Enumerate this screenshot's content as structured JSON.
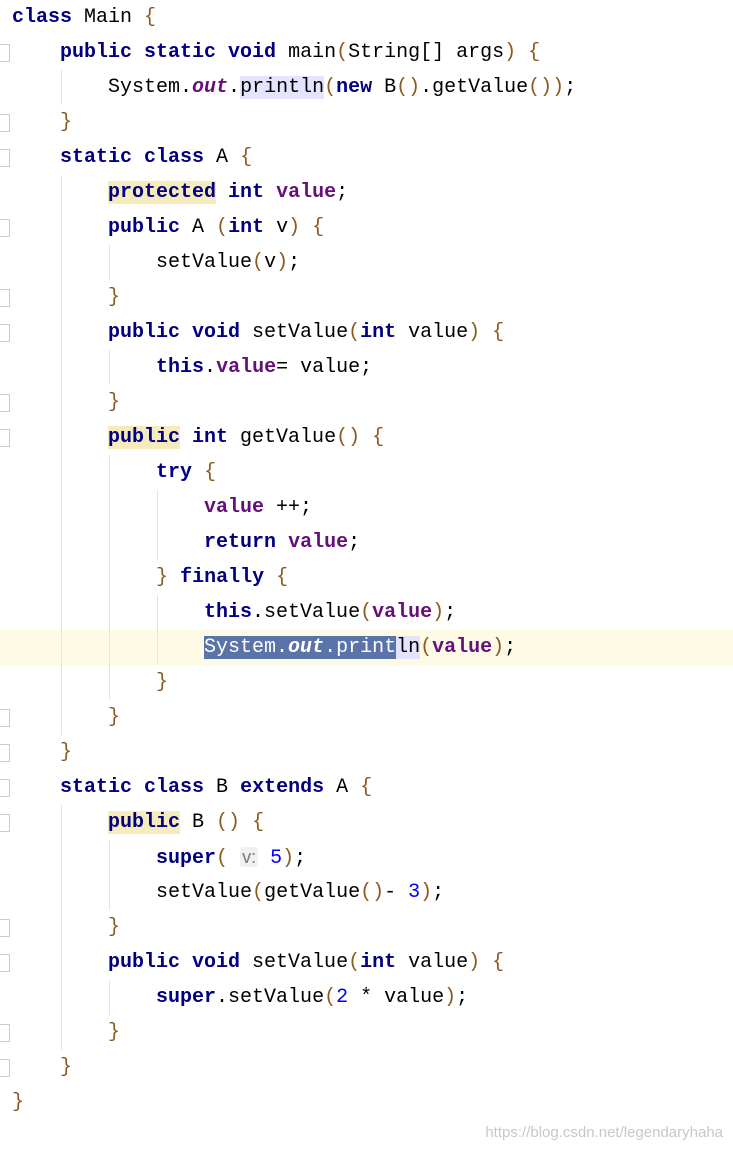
{
  "editor": {
    "colors": {
      "keyword": "#000080",
      "field": "#660e7a",
      "number": "#0000ff",
      "brace": "#8a5a1e",
      "selection": "#5a73a8",
      "current_line": "#fdfae6"
    },
    "current_line": 18,
    "lines": [
      {
        "indent": 0,
        "fold": false,
        "tokens": [
          [
            "class",
            "k"
          ],
          [
            " Main ",
            "p"
          ],
          [
            "{",
            "b"
          ]
        ]
      },
      {
        "indent": 1,
        "fold": true,
        "tokens": [
          [
            "public static void",
            "k"
          ],
          [
            " main",
            "p"
          ],
          [
            "(",
            "b"
          ],
          [
            "String[] args",
            "p"
          ],
          [
            ")",
            "b"
          ],
          [
            " ",
            "p"
          ],
          [
            "{",
            "b"
          ]
        ]
      },
      {
        "indent": 2,
        "fold": false,
        "tokens": [
          [
            "System.",
            "p"
          ],
          [
            "out",
            "i"
          ],
          [
            ".",
            "p"
          ],
          [
            "println",
            "p",
            "hl-u"
          ],
          [
            "(",
            "b"
          ],
          [
            "new",
            "k"
          ],
          [
            " B",
            "p"
          ],
          [
            "()",
            "b"
          ],
          [
            ".getValue",
            "p"
          ],
          [
            "())",
            "b"
          ],
          [
            ";",
            "p"
          ]
        ]
      },
      {
        "indent": 1,
        "fold": true,
        "tokens": [
          [
            "}",
            "b"
          ]
        ]
      },
      {
        "indent": 1,
        "fold": true,
        "tokens": [
          [
            "static class",
            "k"
          ],
          [
            " A ",
            "p"
          ],
          [
            "{",
            "b"
          ]
        ]
      },
      {
        "indent": 2,
        "fold": false,
        "tokens": [
          [
            "protected",
            "k",
            "hl-y"
          ],
          [
            " int",
            "k"
          ],
          [
            " ",
            "p"
          ],
          [
            "value",
            "f"
          ],
          [
            ";",
            "p"
          ]
        ]
      },
      {
        "indent": 2,
        "fold": true,
        "tokens": [
          [
            "public",
            "k"
          ],
          [
            " A ",
            "p"
          ],
          [
            "(",
            "b"
          ],
          [
            "int",
            "k"
          ],
          [
            " v",
            "p"
          ],
          [
            ")",
            "b"
          ],
          [
            " ",
            "p"
          ],
          [
            "{",
            "b"
          ]
        ]
      },
      {
        "indent": 3,
        "fold": false,
        "tokens": [
          [
            "setValue",
            "p"
          ],
          [
            "(",
            "b"
          ],
          [
            "v",
            "p"
          ],
          [
            ")",
            "b"
          ],
          [
            ";",
            "p"
          ]
        ]
      },
      {
        "indent": 2,
        "fold": true,
        "tokens": [
          [
            "}",
            "b"
          ]
        ]
      },
      {
        "indent": 2,
        "fold": true,
        "tokens": [
          [
            "public void",
            "k"
          ],
          [
            " setValue",
            "p"
          ],
          [
            "(",
            "b"
          ],
          [
            "int",
            "k"
          ],
          [
            " value",
            "p"
          ],
          [
            ")",
            "b"
          ],
          [
            " ",
            "p"
          ],
          [
            "{",
            "b"
          ]
        ]
      },
      {
        "indent": 3,
        "fold": false,
        "tokens": [
          [
            "this",
            "k"
          ],
          [
            ".",
            "p"
          ],
          [
            "value",
            "f"
          ],
          [
            "= value;",
            "p"
          ]
        ]
      },
      {
        "indent": 2,
        "fold": true,
        "tokens": [
          [
            "}",
            "b"
          ]
        ]
      },
      {
        "indent": 2,
        "fold": true,
        "tokens": [
          [
            "public",
            "k",
            "hl-y"
          ],
          [
            " int",
            "k"
          ],
          [
            " getValue",
            "p"
          ],
          [
            "()",
            "b"
          ],
          [
            " ",
            "p"
          ],
          [
            "{",
            "b"
          ]
        ]
      },
      {
        "indent": 3,
        "fold": false,
        "tokens": [
          [
            "try",
            "k"
          ],
          [
            " ",
            "p"
          ],
          [
            "{",
            "b"
          ]
        ]
      },
      {
        "indent": 4,
        "fold": false,
        "tokens": [
          [
            "value",
            "f"
          ],
          [
            " ++;",
            "p"
          ]
        ]
      },
      {
        "indent": 4,
        "fold": false,
        "tokens": [
          [
            "return",
            "k"
          ],
          [
            " ",
            "p"
          ],
          [
            "value",
            "f"
          ],
          [
            ";",
            "p"
          ]
        ]
      },
      {
        "indent": 3,
        "fold": false,
        "tokens": [
          [
            "}",
            "b"
          ],
          [
            " ",
            "p"
          ],
          [
            "finally",
            "k"
          ],
          [
            " ",
            "p"
          ],
          [
            "{",
            "b"
          ]
        ]
      },
      {
        "indent": 4,
        "fold": false,
        "tokens": [
          [
            "this",
            "k"
          ],
          [
            ".setValue",
            "p"
          ],
          [
            "(",
            "b"
          ],
          [
            "value",
            "f"
          ],
          [
            ")",
            "b"
          ],
          [
            ";",
            "p"
          ]
        ]
      },
      {
        "indent": 4,
        "fold": false,
        "tokens": [
          [
            "System.",
            "p",
            "sel"
          ],
          [
            "out",
            "i",
            "sel"
          ],
          [
            ".print",
            "p",
            "sel"
          ],
          [
            "ln",
            "p",
            "hl-u"
          ],
          [
            "(",
            "b"
          ],
          [
            "value",
            "f"
          ],
          [
            ")",
            "b"
          ],
          [
            ";",
            "p"
          ]
        ]
      },
      {
        "indent": 3,
        "fold": false,
        "tokens": [
          [
            "}",
            "b"
          ]
        ]
      },
      {
        "indent": 2,
        "fold": true,
        "tokens": [
          [
            "}",
            "b"
          ]
        ]
      },
      {
        "indent": 1,
        "fold": true,
        "tokens": [
          [
            "}",
            "b"
          ]
        ]
      },
      {
        "indent": 1,
        "fold": true,
        "tokens": [
          [
            "static class",
            "k"
          ],
          [
            " B ",
            "p"
          ],
          [
            "extends",
            "k"
          ],
          [
            " A ",
            "p"
          ],
          [
            "{",
            "b"
          ]
        ]
      },
      {
        "indent": 2,
        "fold": true,
        "tokens": [
          [
            "public",
            "k",
            "hl-y"
          ],
          [
            " B ",
            "p"
          ],
          [
            "()",
            "b"
          ],
          [
            " ",
            "p"
          ],
          [
            "{",
            "b"
          ]
        ]
      },
      {
        "indent": 3,
        "fold": false,
        "tokens": [
          [
            "super",
            "k"
          ],
          [
            "(",
            "b"
          ],
          [
            " ",
            "p"
          ],
          [
            "v:",
            "h"
          ],
          [
            " ",
            "p"
          ],
          [
            "5",
            "n"
          ],
          [
            ")",
            "b"
          ],
          [
            ";",
            "p"
          ]
        ]
      },
      {
        "indent": 3,
        "fold": false,
        "tokens": [
          [
            "setValue",
            "p"
          ],
          [
            "(",
            "b"
          ],
          [
            "getValue",
            "p"
          ],
          [
            "()",
            "b"
          ],
          [
            "- ",
            "p"
          ],
          [
            "3",
            "n"
          ],
          [
            ")",
            "b"
          ],
          [
            ";",
            "p"
          ]
        ]
      },
      {
        "indent": 2,
        "fold": true,
        "tokens": [
          [
            "}",
            "b"
          ]
        ]
      },
      {
        "indent": 2,
        "fold": true,
        "tokens": [
          [
            "public void",
            "k"
          ],
          [
            " setValue",
            "p"
          ],
          [
            "(",
            "b"
          ],
          [
            "int",
            "k"
          ],
          [
            " value",
            "p"
          ],
          [
            ")",
            "b"
          ],
          [
            " ",
            "p"
          ],
          [
            "{",
            "b"
          ]
        ]
      },
      {
        "indent": 3,
        "fold": false,
        "tokens": [
          [
            "super",
            "k"
          ],
          [
            ".setValue",
            "p"
          ],
          [
            "(",
            "b"
          ],
          [
            "2",
            "n"
          ],
          [
            " * value",
            "p"
          ],
          [
            ")",
            "b"
          ],
          [
            ";",
            "p"
          ]
        ]
      },
      {
        "indent": 2,
        "fold": true,
        "tokens": [
          [
            "}",
            "b"
          ]
        ]
      },
      {
        "indent": 1,
        "fold": true,
        "tokens": [
          [
            "}",
            "b"
          ]
        ]
      },
      {
        "indent": 0,
        "fold": false,
        "tokens": [
          [
            "}",
            "b"
          ]
        ]
      }
    ]
  },
  "watermark": "https://blog.csdn.net/legendaryhaha"
}
